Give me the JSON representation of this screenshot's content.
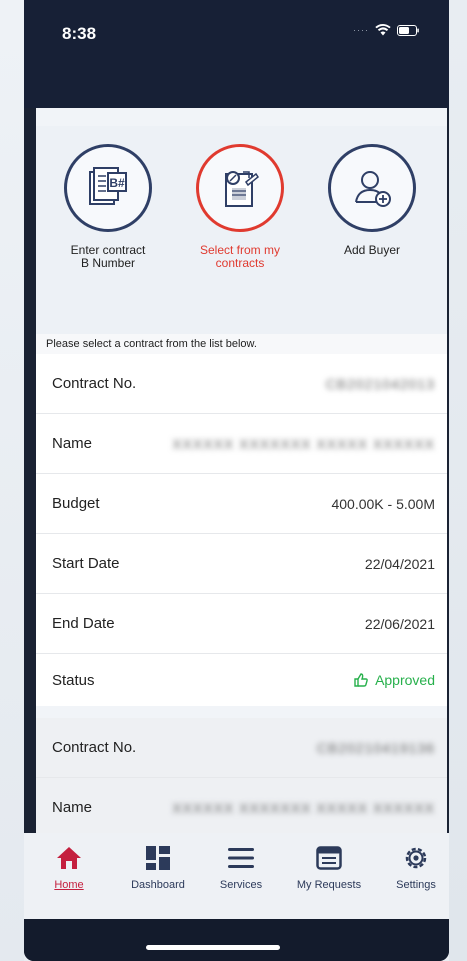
{
  "status_bar": {
    "time": "8:38"
  },
  "options": [
    {
      "id": "enter",
      "label": "Enter contract\nB Number",
      "icon": "document-b-number-icon",
      "active": false
    },
    {
      "id": "select",
      "label": "Select from my\ncontracts",
      "icon": "contract-form-icon",
      "active": true
    },
    {
      "id": "add",
      "label": "Add Buyer",
      "icon": "add-user-icon",
      "active": false
    }
  ],
  "instruction": "Please select a contract from the list below.",
  "contracts": [
    {
      "contract_no": {
        "label": "Contract No.",
        "value": "CB2021042013"
      },
      "name": {
        "label": "Name",
        "value": "XXXXXX XXXXXXX XXXXX XXXXXX"
      },
      "budget": {
        "label": "Budget",
        "value": "400.00K - 5.00M"
      },
      "start_date": {
        "label": "Start Date",
        "value": "22/04/2021"
      },
      "end_date": {
        "label": "End Date",
        "value": "22/06/2021"
      },
      "status": {
        "label": "Status",
        "value": "Approved"
      }
    },
    {
      "contract_no": {
        "label": "Contract No.",
        "value": "CB20210419136"
      },
      "name": {
        "label": "Name",
        "value": "XXXXXX XXXXXXX XXXXX XXXXXX"
      }
    }
  ],
  "tabs": [
    {
      "label": "Home",
      "icon": "home-icon",
      "active": true
    },
    {
      "label": "Dashboard",
      "icon": "dashboard-icon",
      "active": false
    },
    {
      "label": "Services",
      "icon": "services-menu-icon",
      "active": false
    },
    {
      "label": "My Requests",
      "icon": "my-requests-icon",
      "active": false
    },
    {
      "label": "Settings",
      "icon": "settings-gear-icon",
      "active": false
    }
  ],
  "colors": {
    "accent": "#e03a2f",
    "navy": "#2f3f66",
    "approved": "#27b04c",
    "home_active": "#c41f3e"
  }
}
